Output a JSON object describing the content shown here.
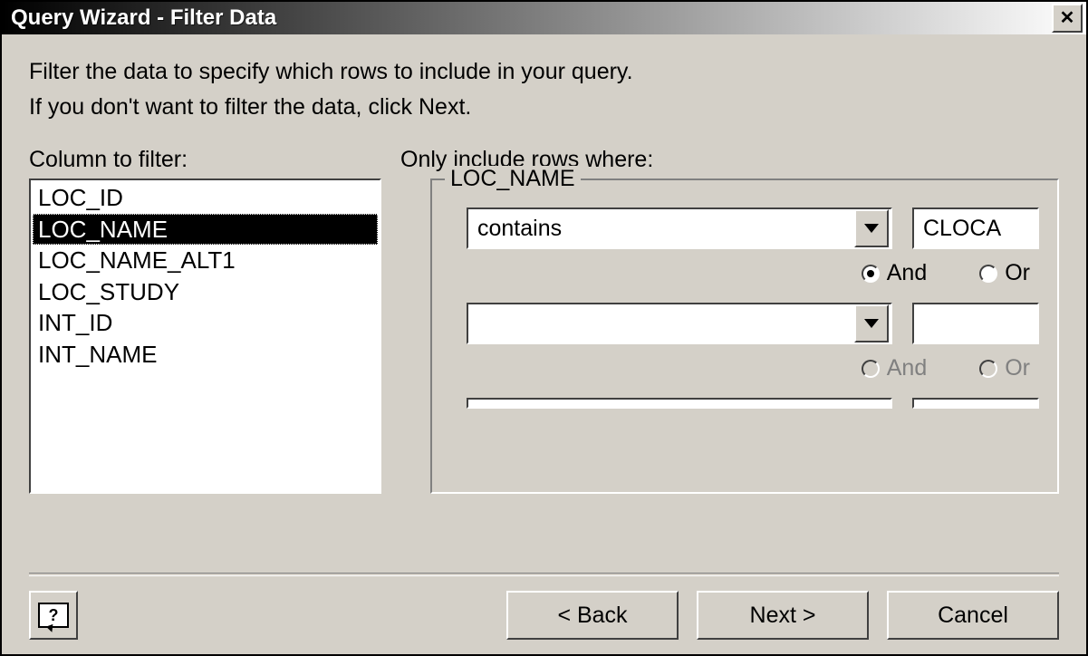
{
  "window": {
    "title": "Query Wizard - Filter Data"
  },
  "instructions": {
    "line1": "Filter the data to specify which rows to include in your query.",
    "line2": "If you don't want to filter the data, click Next."
  },
  "labels": {
    "column_to_filter": "Column to filter:",
    "only_include": "Only include rows where:"
  },
  "columns": {
    "items": [
      "LOC_ID",
      "LOC_NAME",
      "LOC_NAME_ALT1",
      "LOC_STUDY",
      "INT_ID",
      "INT_NAME"
    ],
    "selected_index": 1
  },
  "filter": {
    "legend": "LOC_NAME",
    "rows": [
      {
        "operator": "contains",
        "value": "CLOCA",
        "and_or": "And",
        "enabled": true
      },
      {
        "operator": "",
        "value": "",
        "and_or": "",
        "enabled": false
      }
    ],
    "radio_labels": {
      "and": "And",
      "or": "Or"
    }
  },
  "buttons": {
    "back": "< Back",
    "next": "Next >",
    "cancel": "Cancel",
    "help": "?"
  }
}
